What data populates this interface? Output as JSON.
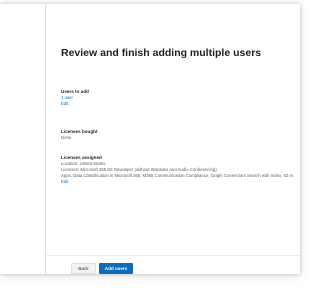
{
  "page": {
    "title": "Review and finish adding multiple users"
  },
  "users_to_add": {
    "label": "Users to add",
    "value": "1 user",
    "edit": "Edit"
  },
  "licenses_bought": {
    "label": "Licenses bought",
    "value": "None"
  },
  "licenses_assigned": {
    "label": "Licenses assigned",
    "location": "Location: United States",
    "licenses": "Licenses: Microsoft 365 E5 Developer (without Windows and Audio Conferencing)",
    "apps": "Apps: Data Classification in Microsoft 365, M365 Communication Compliance, Graph Connectors Search with Index, 53 m",
    "edit": "Edit"
  },
  "footer": {
    "back_label": "Back",
    "add_label": "Add users"
  },
  "colors": {
    "accent": "#0f6cbd",
    "text": "#201f1e",
    "secondary_text": "#605e5c"
  }
}
